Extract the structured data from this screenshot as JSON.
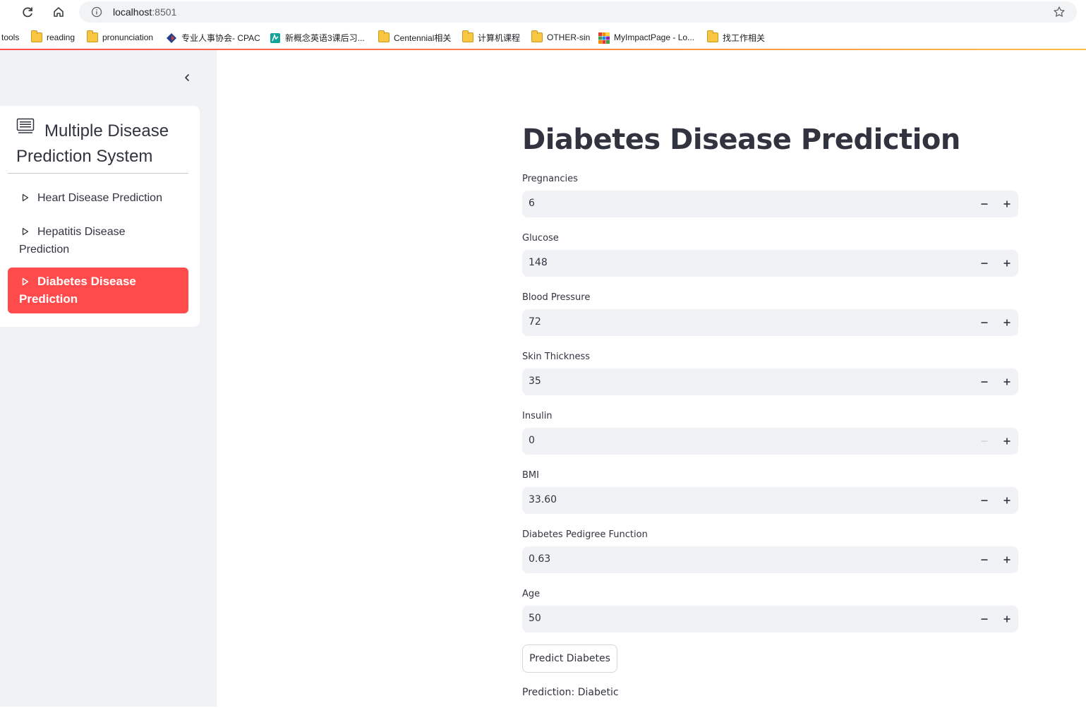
{
  "browser": {
    "url_host": "localhost",
    "url_port": ":8501"
  },
  "bookmarks": [
    {
      "label": "tools",
      "icon": "none"
    },
    {
      "label": "reading",
      "icon": "folder-icon"
    },
    {
      "label": "pronunciation",
      "icon": "folder-icon"
    },
    {
      "label": "专业人事协会- CPAC",
      "icon": "cpac-logo-icon"
    },
    {
      "label": "新概念英语3课后习...",
      "icon": "site-icon"
    },
    {
      "label": "Centennial相关",
      "icon": "folder-icon"
    },
    {
      "label": "计算机课程",
      "icon": "folder-icon"
    },
    {
      "label": "OTHER-sin",
      "icon": "folder-icon"
    },
    {
      "label": "MyImpactPage - Lo...",
      "icon": "grid-logo-icon"
    },
    {
      "label": "找工作相关",
      "icon": "folder-icon"
    }
  ],
  "sidebar": {
    "title": "Multiple Disease Prediction System",
    "items": [
      {
        "label": "Heart Disease Prediction",
        "active": false
      },
      {
        "label": "Hepatitis Disease Prediction",
        "active": false
      },
      {
        "label": "Diabetes Disease Prediction",
        "active": true
      }
    ],
    "accent_color": "#ff4b4b"
  },
  "main": {
    "title": "Diabetes Disease Prediction",
    "fields": [
      {
        "label": "Pregnancies",
        "value": "6"
      },
      {
        "label": "Glucose",
        "value": "148"
      },
      {
        "label": "Blood Pressure",
        "value": "72"
      },
      {
        "label": "Skin Thickness",
        "value": "35"
      },
      {
        "label": "Insulin",
        "value": "0"
      },
      {
        "label": "BMI",
        "value": "33.60"
      },
      {
        "label": "Diabetes Pedigree Function",
        "value": "0.63"
      },
      {
        "label": "Age",
        "value": "50"
      }
    ],
    "predict_button": "Predict Diabetes",
    "result": "Prediction: Diabetic"
  }
}
